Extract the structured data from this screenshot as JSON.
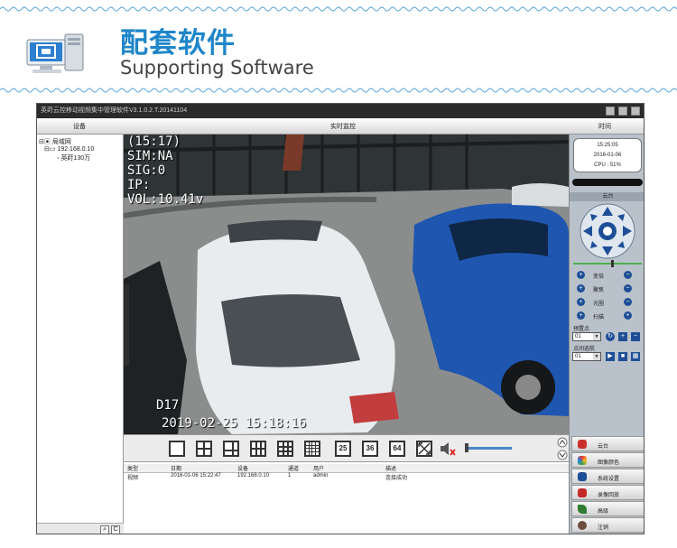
{
  "header": {
    "title_cn": "配套软件",
    "title_en": "Supporting Software"
  },
  "app": {
    "window_title": "英莳云控移动视频集中管理软件V3.1.0.2.T.20141104",
    "col_headers": {
      "devices": "设备",
      "monitor": "实时监控",
      "time": "时间"
    },
    "device_tree": {
      "root": "局域网",
      "ip": "192.168.0.10",
      "device": "英莳130万"
    },
    "osd": {
      "channel_time": "(15:17)",
      "sim": "SIM:NA",
      "sig": "SIG:0",
      "ip": "IP:",
      "vol": "VOL:10.41v",
      "camera_label": "D17",
      "timestamp": "2019-02-25 15:18:16"
    },
    "toolbar": {
      "split_25": "25",
      "split_36": "36",
      "split_64": "64"
    },
    "log": {
      "columns": [
        "类型",
        "日期",
        "设备",
        "通道",
        "用户",
        "描述"
      ],
      "rows": [
        {
          "type": "视频",
          "date": "2016-01-06 15:22:47",
          "device": "192.168.0.10",
          "channel": "1",
          "user": "admin",
          "desc": "连接成功"
        }
      ]
    },
    "clock": {
      "time": "15:25:05",
      "date": "2016-01-06",
      "cpu": "CPU : 51%"
    },
    "ptz": {
      "title": "云台",
      "controls": [
        "变倍",
        "聚焦",
        "光圈",
        "扫描"
      ],
      "preset_label": "预置点",
      "preset_value": "01",
      "cruise_label": "点间巡航",
      "cruise_value": "01"
    },
    "menu": [
      "云台",
      "图像颜色",
      "系统设置",
      "录像回放",
      "高级",
      "注销"
    ]
  },
  "colors": {
    "title_blue": "#1f86c9",
    "accent_navy": "#1e4f96"
  }
}
